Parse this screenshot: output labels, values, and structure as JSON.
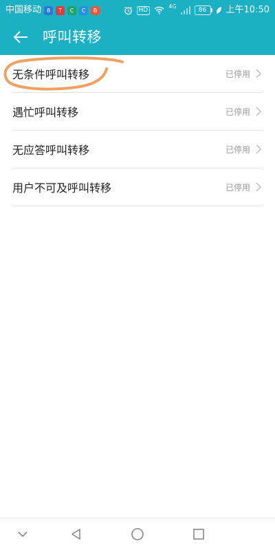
{
  "status_bar": {
    "carrier": "中国移动",
    "mini_app_icons": [
      {
        "name": "mini-app-icon-8",
        "glyph": "8",
        "color": "#2A77D4"
      },
      {
        "name": "mini-app-icon-red",
        "glyph": "T",
        "color": "#E03C3C"
      },
      {
        "name": "mini-app-icon-green",
        "glyph": "C",
        "color": "#1EA36A"
      },
      {
        "name": "mini-app-icon-blue",
        "glyph": "C",
        "color": "#2B8FE0"
      },
      {
        "name": "mini-app-icon-red2",
        "glyph": "B",
        "color": "#E45A3A"
      }
    ],
    "hd": "HD",
    "network": "4G",
    "battery": "86",
    "time": "上午10:50"
  },
  "header": {
    "title": "呼叫转移",
    "background_color": "#1CB0C4"
  },
  "list": {
    "items": [
      {
        "label": "无条件呼叫转移",
        "status": "已停用"
      },
      {
        "label": "遇忙呼叫转移",
        "status": "已停用"
      },
      {
        "label": "无应答呼叫转移",
        "status": "已停用"
      },
      {
        "label": "用户不可及呼叫转移",
        "status": "已停用"
      }
    ]
  },
  "annotation": {
    "color": "#F0A060"
  },
  "nav_bar": {
    "buttons": [
      "chevron-down-icon",
      "back-triangle-icon",
      "home-circle-icon",
      "recents-square-icon"
    ]
  }
}
